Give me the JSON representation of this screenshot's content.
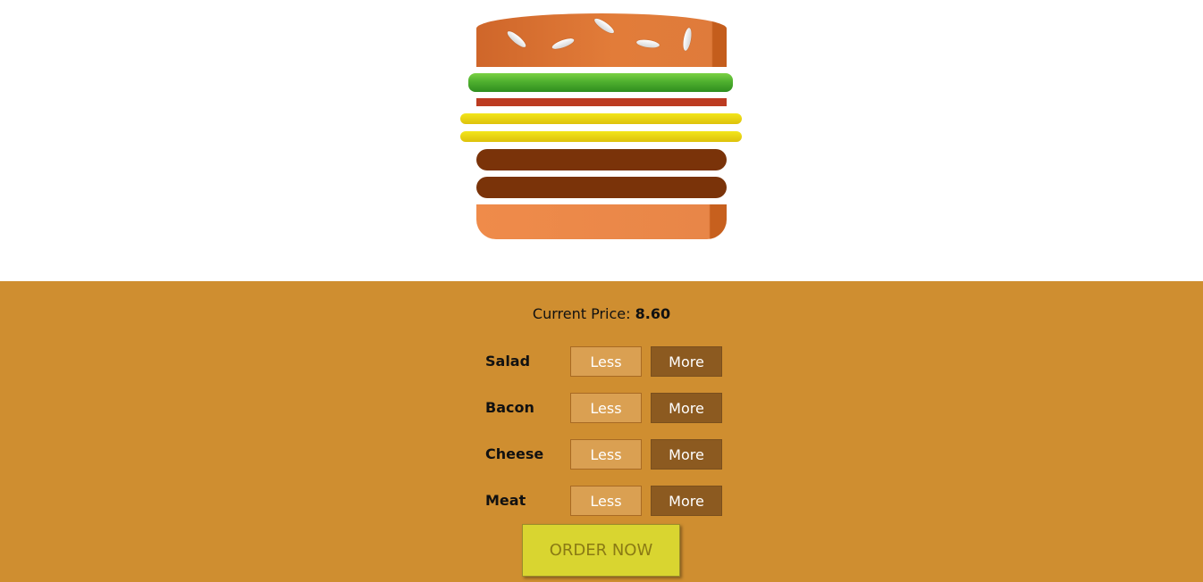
{
  "burger": {
    "layers": [
      "bun-top",
      "salad",
      "bacon",
      "cheese",
      "cheese",
      "meat",
      "meat",
      "bun-bottom"
    ],
    "colors": {
      "bun": "#e27c39",
      "salad": "#4fb02f",
      "bacon": "#bc3b21",
      "cheese": "#ecd415",
      "meat": "#7a3309"
    }
  },
  "price": {
    "label": "Current Price:",
    "value": "8.60"
  },
  "ingredients": [
    {
      "label": "Salad",
      "less": "Less",
      "more": "More"
    },
    {
      "label": "Bacon",
      "less": "Less",
      "more": "More"
    },
    {
      "label": "Cheese",
      "less": "Less",
      "more": "More"
    },
    {
      "label": "Meat",
      "less": "Less",
      "more": "More"
    }
  ],
  "order_button": "ORDER NOW",
  "colors": {
    "panel_background": "#cf8e30",
    "less_button": "#daa052",
    "more_button": "#8c5a20",
    "order_button": "#d9d530"
  }
}
